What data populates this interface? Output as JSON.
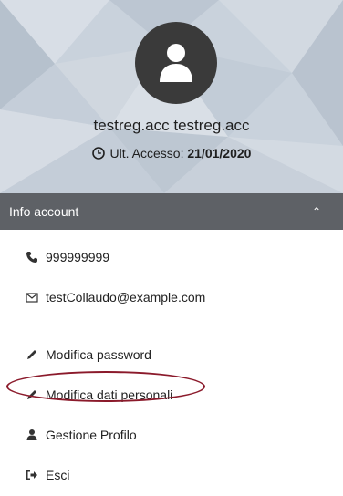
{
  "profile": {
    "name": "testreg.acc testreg.acc",
    "last_access_label": "Ult. Accesso:",
    "last_access_date": "21/01/2020"
  },
  "info_section": {
    "title": "Info account",
    "toggle_icon": "chevron-up-icon"
  },
  "contacts": {
    "phone": "999999999",
    "email": "testCollaudo@example.com"
  },
  "actions": [
    {
      "label": "Modifica password",
      "icon": "pencil-icon"
    },
    {
      "label": "Modifica dati personali",
      "icon": "pencil-icon"
    },
    {
      "label": "Gestione Profilo",
      "icon": "user-icon"
    },
    {
      "label": "Esci",
      "icon": "sign-out-icon"
    }
  ],
  "colors": {
    "header_bg": "#c9d2dc",
    "avatar_bg": "#3a3a3a",
    "info_bar_bg": "#5e6166",
    "highlight_ellipse": "#8b1a2b"
  }
}
